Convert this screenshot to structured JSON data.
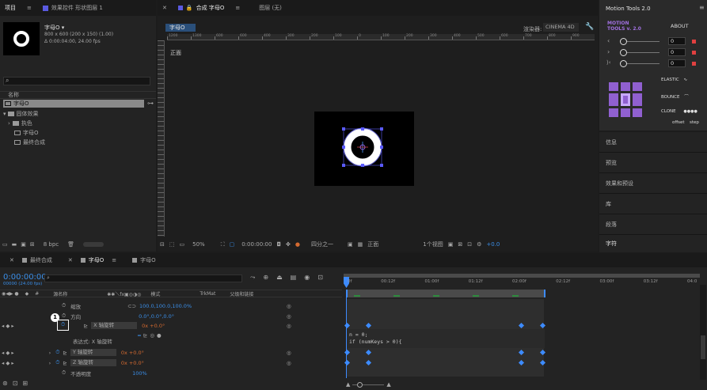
{
  "project": {
    "tab_project": "项目",
    "tab_effects": "效果控件 形状图层 1",
    "item_name": "字母O ▾",
    "item_size": "800 x 600 (200 x 150) (1.00)",
    "item_duration": "Δ 0:00:04:00, 24.00 fps",
    "col_name": "名称",
    "tree": [
      {
        "label": "字母O",
        "selected": true
      },
      {
        "label": "固体效果"
      },
      {
        "label": "执色"
      },
      {
        "label": "字母O"
      },
      {
        "label": "最终合成"
      }
    ],
    "bpc": "8 bpc"
  },
  "composition": {
    "tab_comp": "合成 字母O",
    "tab_layer": "图层 (无)",
    "comp_chip": "字母O",
    "renderer_label": "渲染器:",
    "renderer": "CINEMA 4D",
    "view_label": "正面",
    "ruler_labels": [
      "1200",
      "1300",
      "600",
      "600",
      "400",
      "300",
      "200",
      "100",
      "0",
      "100",
      "200",
      "300",
      "400",
      "500",
      "600",
      "700",
      "800",
      "900"
    ],
    "zoom": "50%",
    "timecode": "0:00:00:00",
    "resolution": "四分之一",
    "camera": "正面",
    "views": "1个视图",
    "exposure": "+0.0"
  },
  "motion_tools": {
    "title": "Motion Tools 2.0",
    "logo_line1": "MOTION",
    "logo_line2": "TOOLS v. 2.0",
    "about": "ABOUT",
    "sliders": [
      {
        "value": "0"
      },
      {
        "value": "0"
      },
      {
        "value": "0"
      }
    ],
    "elastic": "ELASTIC",
    "bounce": "BOUNCE",
    "clone": "CLONE",
    "clone_dots": "●●●●",
    "offset": "offset",
    "step": "step",
    "accent": "#a070e0"
  },
  "side_panels": [
    "信息",
    "预览",
    "效果和预设",
    "库",
    "段落",
    "字符"
  ],
  "timeline": {
    "tab_final": "最终合成",
    "tab_letter": "字母O",
    "tab_letter2": "字母O",
    "timecode": "0:00:00:00",
    "fps": "00000 (24.00 fps)",
    "search_placeholder": "ρ",
    "col_source": "源名称",
    "col_mode": "模式",
    "col_trkmat": "TrkMat",
    "col_parent": "父级和链接",
    "time_labels": [
      "0f",
      "00:12f",
      "01:00f",
      "01:12f",
      "02:00f",
      "02:12f",
      "03:00f",
      "03:12f",
      "04:0"
    ],
    "layers": [
      {
        "name": "缩放",
        "value": "100.0,100.0,100.0%"
      },
      {
        "name": "方向",
        "value": "0.0°,0.0°,0.0°"
      },
      {
        "name": "X 轴旋转",
        "value": "0x +0.0°",
        "badge": "1"
      },
      {
        "name": "表达式: X 轴旋转",
        "value": ""
      },
      {
        "name": "Y 轴旋转",
        "value": "0x +0.0°"
      },
      {
        "name": "Z 轴旋转",
        "value": "0x +0.0°"
      },
      {
        "name": "不透明度",
        "value": "100%"
      }
    ],
    "expression_line1": "n = 0;",
    "expression_line2": "if (numKeys > 0){"
  }
}
